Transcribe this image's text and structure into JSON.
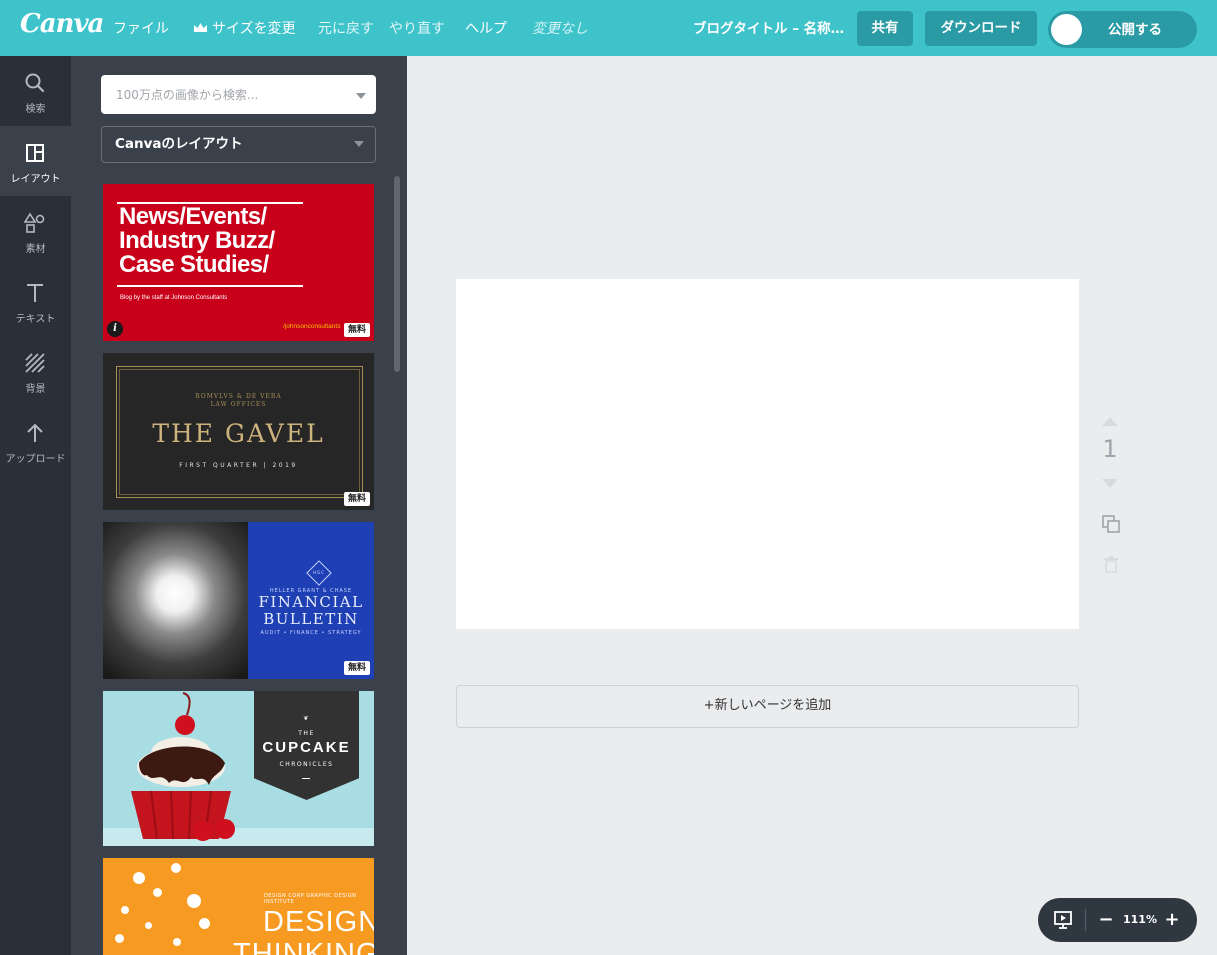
{
  "app": {
    "logo": "Canva",
    "accent_color": "#3ec3cb"
  },
  "topbar": {
    "menu": {
      "file": "ファイル",
      "resize": "サイズを変更",
      "undo": "元に戻す",
      "redo": "やり直す",
      "help": "ヘルプ",
      "status": "変更なし"
    },
    "doc_title": "ブログタイトル – 名称…",
    "share": "共有",
    "download": "ダウンロード",
    "publish": "公開する"
  },
  "rail": {
    "items": [
      {
        "label": "検索",
        "icon": "search-icon"
      },
      {
        "label": "レイアウト",
        "icon": "layout-icon",
        "active": true
      },
      {
        "label": "素材",
        "icon": "elements-icon"
      },
      {
        "label": "テキスト",
        "icon": "text-icon"
      },
      {
        "label": "背景",
        "icon": "background-icon"
      },
      {
        "label": "アップロード",
        "icon": "upload-icon"
      }
    ]
  },
  "panel": {
    "search_placeholder": "100万点の画像から検索...",
    "dropdown": "Canvaのレイアウト",
    "free_badge": "無料",
    "templates": {
      "t1": {
        "headline_1": "News/Events/",
        "headline_2": "Industry Buzz/",
        "headline_3": "Case Studies/",
        "sub": "Blog by the staff at Johnson Consultants",
        "site": "/johnsonconsultants"
      },
      "t2": {
        "firm_1": "ROMVLVS & DE VERA",
        "firm_2": "LAW OFFICES",
        "title": "THE GAVEL",
        "quarter": "FIRST QUARTER | 2019"
      },
      "t3": {
        "mono": "HGC",
        "firm": "HELLER GRANT & CHASE",
        "title_1": "FINANCIAL",
        "title_2": "BULLETIN",
        "tagline": "AUDIT • FINANCE • STRATEGY"
      },
      "t4": {
        "the": "THE",
        "title": "CUPCAKE",
        "sub": "CHRONICLES"
      },
      "t5": {
        "tag": "DESIGN CORP GRAPHIC DESIGN INSTITUTE",
        "title_1": "DESIGN",
        "title_2": "THINKING"
      }
    }
  },
  "canvas": {
    "add_page": "+新しいページを追加",
    "page_number": "1"
  },
  "zoom": {
    "value": "111%",
    "minus": "−",
    "plus": "+"
  }
}
